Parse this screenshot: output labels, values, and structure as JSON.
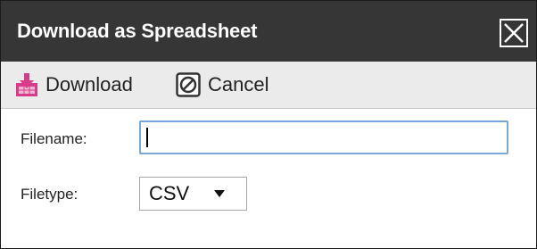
{
  "dialog": {
    "title": "Download as Spreadsheet",
    "close_icon": "close-icon"
  },
  "toolbar": {
    "download_label": "Download",
    "download_icon": "download-icon",
    "cancel_label": "Cancel",
    "cancel_icon": "cancel-icon"
  },
  "form": {
    "filename_label": "Filename:",
    "filename_value": "",
    "filetype_label": "Filetype:",
    "filetype_selected": "CSV"
  },
  "colors": {
    "titlebar": "#363636",
    "toolbar": "#ebebeb",
    "download_icon": "#d63c8a",
    "input_focus_border": "#7aa7d8"
  }
}
